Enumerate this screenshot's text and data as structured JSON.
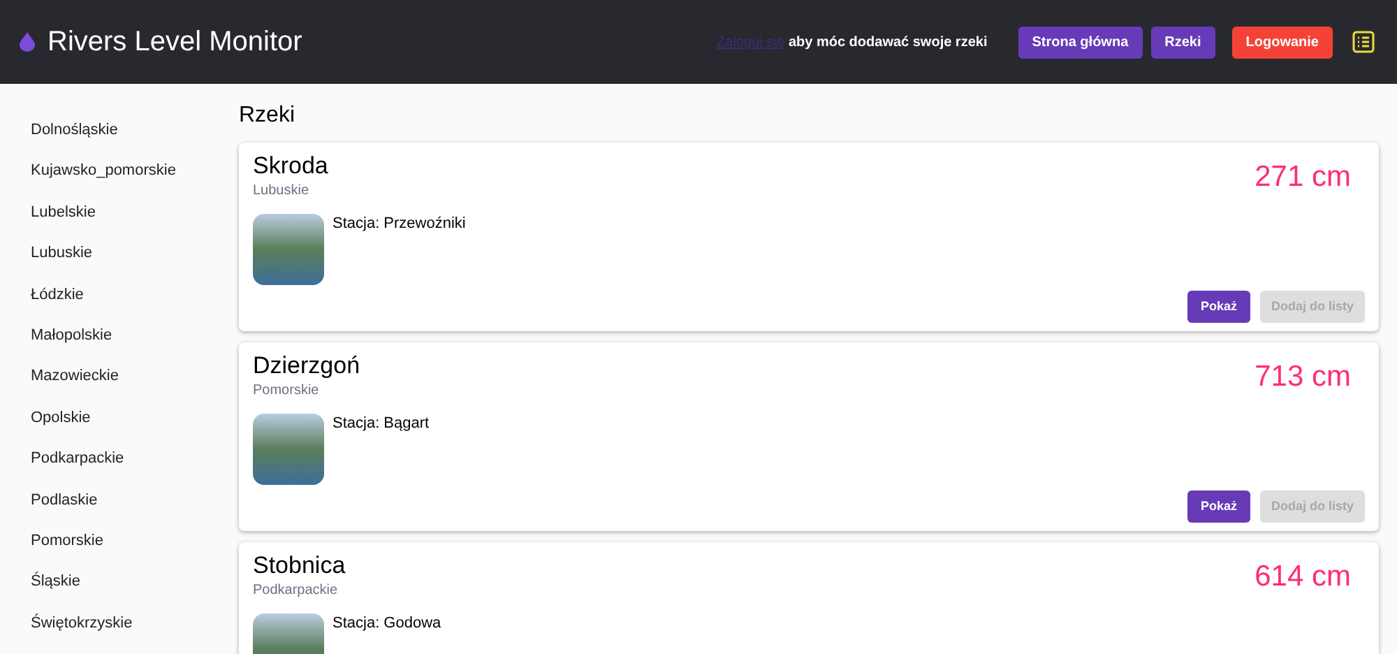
{
  "header": {
    "title": "Rivers Level Monitor",
    "login_link": "Zaloguj się",
    "login_hint": "aby móc dodawać swoje rzeki",
    "nav": [
      {
        "label": "Strona główna",
        "kind": "primary"
      },
      {
        "label": "Rzeki",
        "kind": "primary"
      },
      {
        "label": "Logowanie",
        "kind": "danger"
      }
    ]
  },
  "sidebar": {
    "items": [
      "Dolnośląskie",
      "Kujawsko_pomorskie",
      "Lubelskie",
      "Lubuskie",
      "Łódzkie",
      "Małopolskie",
      "Mazowieckie",
      "Opolskie",
      "Podkarpackie",
      "Podlaskie",
      "Pomorskie",
      "Śląskie",
      "Świętokrzyskie"
    ]
  },
  "page_title": "Rzeki",
  "rivers": [
    {
      "name": "Skroda",
      "region": "Lubuskie",
      "level": "271 cm",
      "station": "Stacja: Przewoźniki",
      "show_button": "Pokaż",
      "add_button": {
        "label": "Dodaj do listy",
        "disabled": true
      }
    },
    {
      "name": "Dzierzgoń",
      "region": "Pomorskie",
      "level": "713 cm",
      "station": "Stacja: Bągart",
      "show_button": "Pokaż",
      "add_button": {
        "label": "Dodaj do listy",
        "disabled": true
      }
    },
    {
      "name": "Stobnica",
      "region": "Podkarpackie",
      "level": "614 cm",
      "station": "Stacja: Godowa"
    }
  ]
}
